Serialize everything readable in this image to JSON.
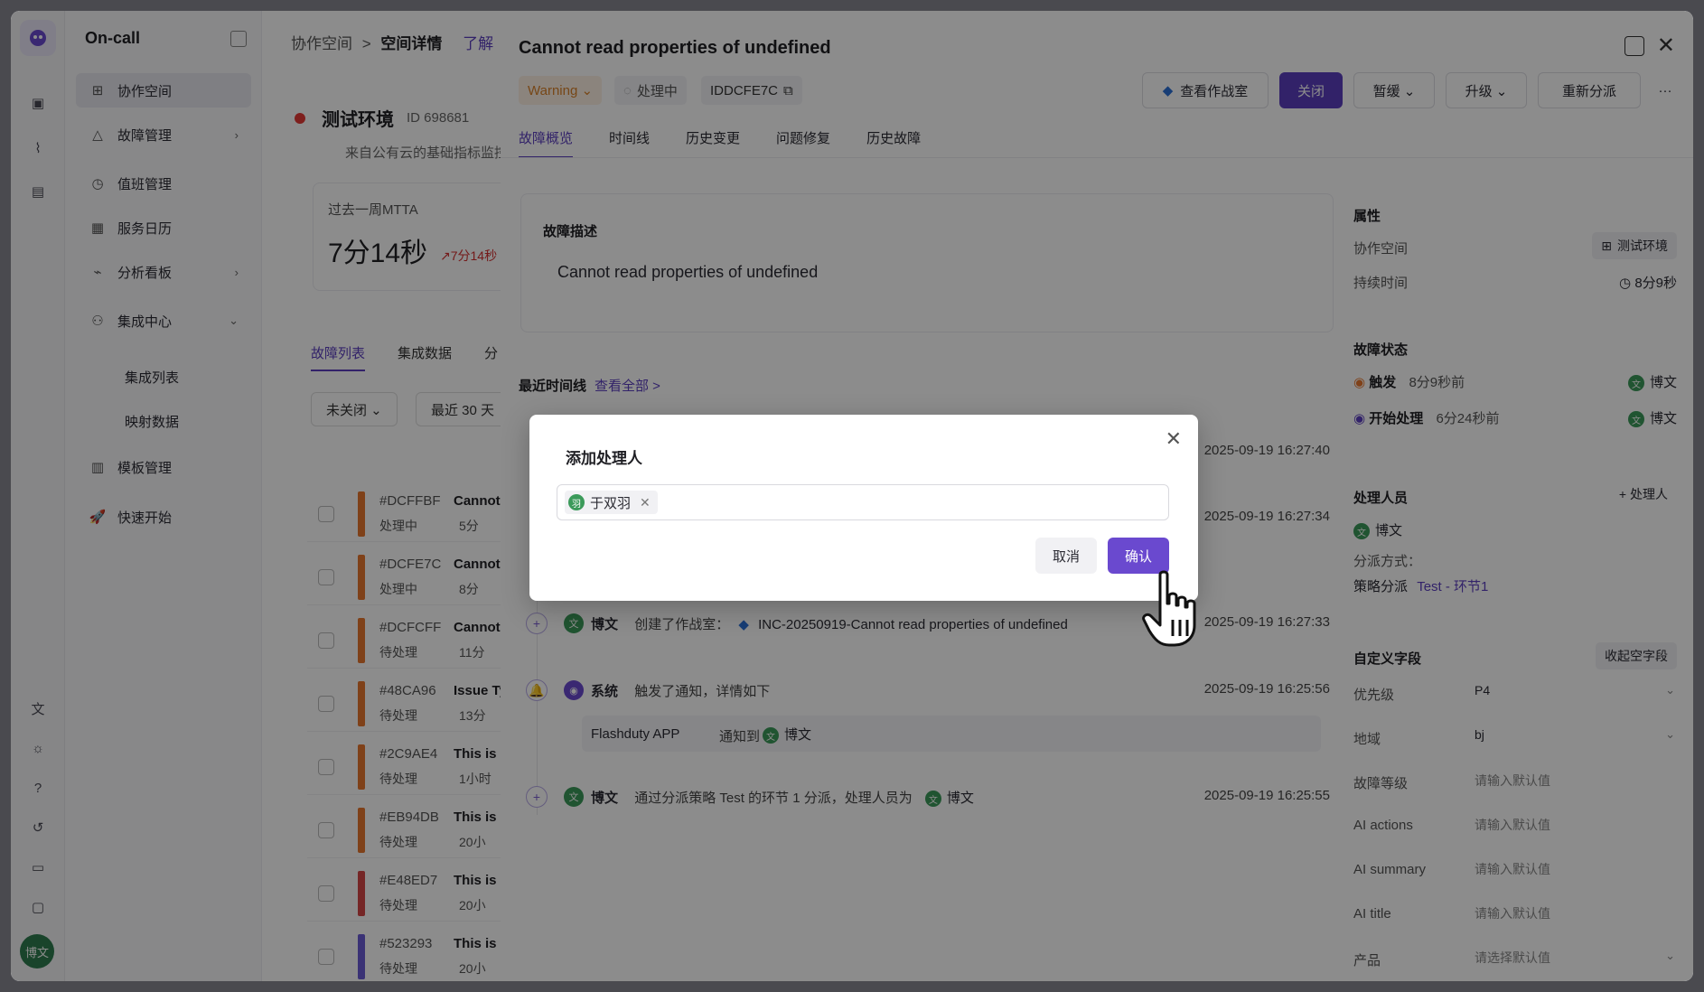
{
  "sidebar": {
    "brand": "On-call",
    "items": [
      {
        "label": "协作空间",
        "icon": "workspace-icon",
        "active": true
      },
      {
        "label": "故障管理",
        "icon": "alert-icon",
        "chevron": "›"
      },
      {
        "label": "值班管理",
        "icon": "calendar-clock-icon"
      },
      {
        "label": "服务日历",
        "icon": "calendar-icon"
      },
      {
        "label": "分析看板",
        "icon": "chart-icon",
        "chevron": "›"
      },
      {
        "label": "集成中心",
        "icon": "integration-icon",
        "chevron": "⌄"
      },
      {
        "label": "模板管理",
        "icon": "template-icon"
      },
      {
        "label": "快速开始",
        "icon": "rocket-icon"
      }
    ],
    "sub_items": [
      "集成列表",
      "映射数据"
    ],
    "user_avatar": "博文"
  },
  "bg": {
    "breadcrumb_1": "协作空间",
    "breadcrumb_sep": ">",
    "breadcrumb_2": "空间详情",
    "breadcrumb_link": "了解",
    "space_name": "测试环境",
    "space_id": "ID 698681",
    "space_desc": "来自公有云的基础指标监控",
    "mtta_label": "过去一周MTTA",
    "mtta_value": "7分14秒",
    "mtta_delta": "↗7分14秒",
    "tabs": [
      "故障列表",
      "集成数据",
      "分"
    ],
    "filter_1": "未关闭 ⌄",
    "filter_2": "最近 30 天",
    "rows": [
      {
        "id": "#DCFFBF",
        "title": "Cannot",
        "status": "处理中",
        "time": "5分",
        "color": "#e8772e"
      },
      {
        "id": "#DCFE7C",
        "title": "Cannot",
        "status": "处理中",
        "time": "8分",
        "color": "#e8772e"
      },
      {
        "id": "#DCFCFF",
        "title": "Cannot",
        "status": "待处理",
        "time": "11分",
        "color": "#e8772e"
      },
      {
        "id": "#48CA96",
        "title": "Issue Ty",
        "status": "待处理",
        "time": "13分",
        "color": "#e8772e"
      },
      {
        "id": "#2C9AE4",
        "title": "This is a",
        "status": "待处理",
        "time": "1小时",
        "color": "#e8772e"
      },
      {
        "id": "#EB94DB",
        "title": "This is a",
        "status": "待处理",
        "time": "20小",
        "color": "#e8772e"
      },
      {
        "id": "#E48ED7",
        "title": "This is a",
        "status": "待处理",
        "time": "20小",
        "color": "#d64545"
      },
      {
        "id": "#523293",
        "title": "This is a",
        "status": "待处理",
        "time": "20小",
        "color": "#6b5bd6"
      }
    ]
  },
  "drawer": {
    "title": "Cannot read properties of undefined",
    "severity": "Warning ⌄",
    "status": "处理中",
    "incident_id": "IDDCFE7C",
    "buttons": {
      "war_room": "查看作战室",
      "close": "关闭",
      "snooze": "暂缓 ⌄",
      "escalate": "升级 ⌄",
      "reassign": "重新分派",
      "more": "···"
    },
    "tabs": [
      "故障概览",
      "时间线",
      "历史变更",
      "问题修复",
      "历史故障"
    ],
    "desc_head": "故障描述",
    "desc_text": "Cannot read properties of undefined",
    "timeline_head": "最近时间线",
    "timeline_link": "查看全部 >",
    "timeline": [
      {
        "time": "2025-09-19 16:27:40"
      },
      {
        "time": "2025-09-19 16:27:34"
      },
      {
        "actor": "博文",
        "text": "创建了作战室：",
        "link": "INC-20250919-Cannot read properties of undefined",
        "time": "2025-09-19 16:27:33"
      },
      {
        "actor": "系统",
        "text": "触发了通知，详情如下",
        "time": "2025-09-19 16:25:56",
        "notify_app": "Flashduty APP",
        "notify_to": "通知到",
        "notify_user": "博文"
      },
      {
        "actor": "博文",
        "text": "通过分派策略 Test 的环节 1 分派，处理人员为",
        "user": "博文",
        "time": "2025-09-19 16:25:55"
      }
    ],
    "props": {
      "head": "属性",
      "workspace_k": "协作空间",
      "workspace_v": "测试环境",
      "duration_k": "持续时间",
      "duration_v": "8分9秒",
      "state_head": "故障状态",
      "state_1": "触发",
      "state_1_time": "8分9秒前",
      "state_1_user": "博文",
      "state_2": "开始处理",
      "state_2_time": "6分24秒前",
      "state_2_user": "博文",
      "handlers_head": "处理人员",
      "add_handler": "+ 处理人",
      "handler": "博文",
      "dispatch_k": "分派方式：",
      "dispatch_v": "策略分派",
      "dispatch_link": "Test - 环节1",
      "custom_head": "自定义字段",
      "collapse_empty": "收起空字段",
      "fields": [
        {
          "k": "优先级",
          "v": "P4",
          "chev": true
        },
        {
          "k": "地域",
          "v": "bj",
          "chev": true
        },
        {
          "k": "故障等级",
          "v": "请输入默认值"
        },
        {
          "k": "AI actions",
          "v": "请输入默认值"
        },
        {
          "k": "AI summary",
          "v": "请输入默认值"
        },
        {
          "k": "AI title",
          "v": "请输入默认值"
        },
        {
          "k": "产品",
          "v": "请选择默认值",
          "chev": true
        }
      ]
    }
  },
  "modal": {
    "title": "添加处理人",
    "chip_avatar": "羽",
    "chip_label": "于双羽",
    "cancel": "取消",
    "confirm": "确认"
  },
  "colors": {
    "accent": "#5b3fbf",
    "confirm": "#6a49cf",
    "warning": "#d9822b"
  }
}
